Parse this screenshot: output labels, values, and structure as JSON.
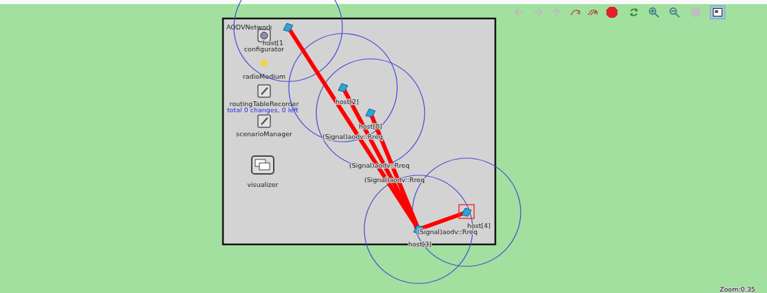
{
  "toolbar": [
    {
      "kind": "back",
      "disabled": true
    },
    {
      "kind": "forward",
      "disabled": true
    },
    {
      "kind": "up",
      "disabled": true
    },
    {
      "kind": "run"
    },
    {
      "kind": "fast"
    },
    {
      "kind": "stop"
    },
    {
      "kind": "refresh"
    },
    {
      "kind": "zoom-in"
    },
    {
      "kind": "zoom-out"
    },
    {
      "kind": "circle"
    },
    {
      "kind": "layout",
      "selected": true
    }
  ],
  "network": {
    "title": "AODVNetwork",
    "modules": [
      {
        "kind": "gear",
        "label": "configurator"
      },
      {
        "kind": "dot",
        "label": "radioMedium"
      },
      {
        "kind": "recorder",
        "label": "routingTableRecorder",
        "status": "total 0 changes, 0 left"
      },
      {
        "kind": "recorder",
        "label": "scenarioManager"
      },
      {
        "kind": "window",
        "label": "visualizer"
      }
    ],
    "hosts": [
      {
        "label": "host[1",
        "selected": false
      },
      {
        "label": "host[2]",
        "selected": false
      },
      {
        "label": "host[0]",
        "selected": false
      },
      {
        "label": "host[4]",
        "selected": true
      },
      {
        "label": "host[3]",
        "selected": false
      }
    ],
    "messages": [
      "(Signal)aodv::Rreq",
      "(Signal)aodv::Rreq",
      "(Signal)aodv::Rreq",
      "(Signal)aodv::Rreq"
    ]
  },
  "zoom": "Zoom:0.35"
}
